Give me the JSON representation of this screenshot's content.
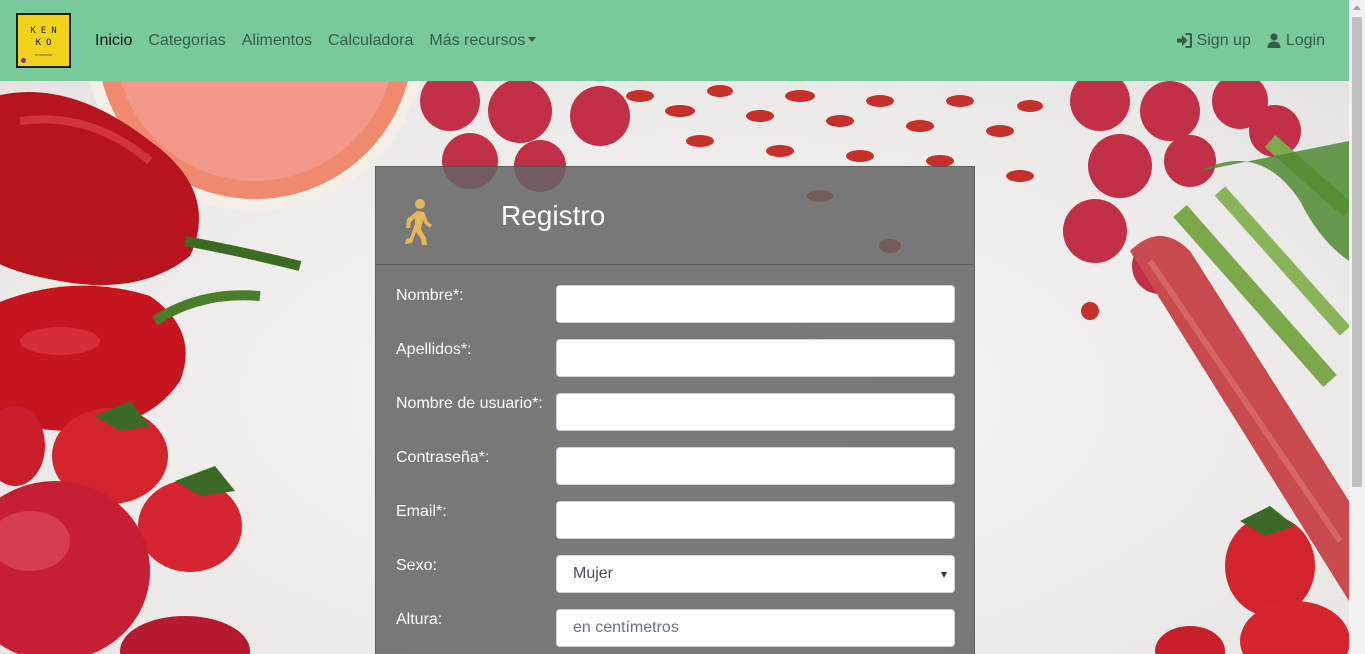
{
  "brand": {
    "logo_line1": "KEN",
    "logo_line2": "KO",
    "logo_caption": "NUTRICIÓN"
  },
  "nav": {
    "links": [
      {
        "label": "Inicio",
        "active": true
      },
      {
        "label": "Categorias"
      },
      {
        "label": "Alimentos"
      },
      {
        "label": "Calculadora"
      },
      {
        "label": "Más recursos",
        "dropdown": true
      }
    ],
    "signup_label": "Sign up",
    "login_label": "Login",
    "signup_icon": "sign-in-icon",
    "login_icon": "user-icon",
    "bar_color": "#78c99c"
  },
  "form": {
    "title": "Registro",
    "icon": "walking-person-icon",
    "icon_color": "#e5b758",
    "fields": [
      {
        "label": "Nombre*:",
        "value": "",
        "placeholder": ""
      },
      {
        "label": "Apellidos*:",
        "value": "",
        "placeholder": ""
      },
      {
        "label": "Nombre de usuario*:",
        "value": "",
        "placeholder": ""
      },
      {
        "label": "Contraseña*:",
        "value": "",
        "placeholder": ""
      },
      {
        "label": "Email*:",
        "value": "",
        "placeholder": ""
      },
      {
        "label": "Sexo:",
        "value": "Mujer",
        "type": "select"
      },
      {
        "label": "Altura:",
        "value": "",
        "placeholder": "en centímetros"
      }
    ]
  }
}
